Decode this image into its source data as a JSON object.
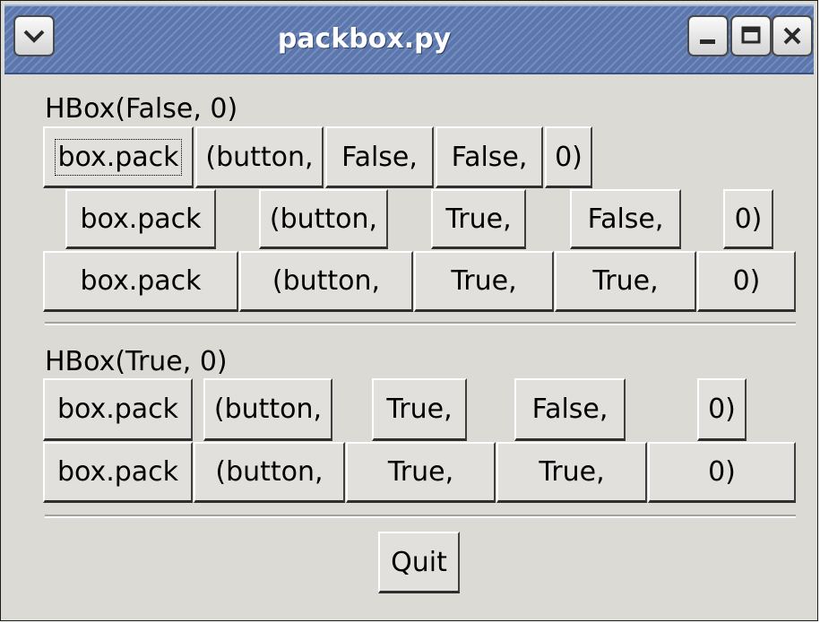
{
  "window": {
    "title": "packbox.py"
  },
  "section1": {
    "label": "HBox(False, 0)",
    "row1": [
      "box.pack",
      "(button,",
      "False,",
      "False,",
      "0)"
    ],
    "row2": [
      "box.pack",
      "(button,",
      "True,",
      "False,",
      "0)"
    ],
    "row3": [
      "box.pack",
      "(button,",
      "True,",
      "True,",
      "0)"
    ]
  },
  "section2": {
    "label": "HBox(True, 0)",
    "row1": [
      "box.pack",
      "(button,",
      "True,",
      "False,",
      "0)"
    ],
    "row2": [
      "box.pack",
      "(button,",
      "True,",
      "True,",
      "0)"
    ]
  },
  "quit_label": "Quit"
}
